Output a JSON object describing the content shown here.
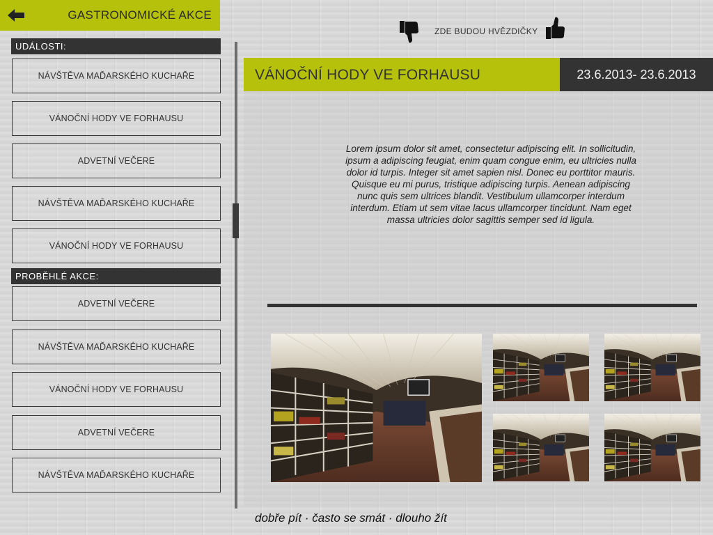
{
  "header": {
    "title": "GASTRONOMICKÉ AKCE"
  },
  "sections": {
    "upcoming_label": "UDÁLOSTI:",
    "past_label": "PROBĚHLÉ AKCE:"
  },
  "upcoming_events": [
    "NÁVŠTĚVA MAĎARSKÉHO KUCHAŘE",
    "VÁNOČNÍ HODY VE FORHAUSU",
    "ADVETNÍ VEČERE",
    "NÁVŠTĚVA MAĎARSKÉHO KUCHAŘE",
    "VÁNOČNÍ HODY VE FORHAUSU"
  ],
  "past_events": [
    "ADVETNÍ VEČERE",
    "NÁVŠTĚVA MAĎARSKÉHO KUCHAŘE",
    "VÁNOČNÍ HODY VE FORHAUSU",
    "ADVETNÍ VEČERE",
    "NÁVŠTĚVA MAĎARSKÉHO KUCHAŘE"
  ],
  "rating": {
    "placeholder_text": "ZDE BUDOU HVĚZDIČKY"
  },
  "event": {
    "title": "VÁNOČNÍ HODY VE FORHAUSU",
    "date_range": "23.6.2013- 23.6.2013",
    "description": "Lorem ipsum dolor sit amet, consectetur adipiscing elit. In sollicitudin, ipsum a adipiscing feugiat, enim quam congue enim, eu ultricies nulla dolor id turpis. Integer sit amet sapien nisl. Donec eu porttitor mauris. Quisque eu mi purus, tristique adipiscing turpis. Aenean adipiscing nunc quis sem ultrices blandit. Vestibulum ullamcorper interdum interdum. Etiam ut sem vitae lacus ullamcorper tincidunt. Nam eget massa ultricies dolor sagittis semper sed id ligula."
  },
  "footer": {
    "motto": "dobře pít · často se smát · dlouho žít"
  },
  "colors": {
    "accent": "#b6c10c",
    "dark": "#333333"
  },
  "icons": {
    "back": "arrow-left-icon",
    "dislike": "thumbs-down-icon",
    "like": "thumbs-up-icon"
  }
}
